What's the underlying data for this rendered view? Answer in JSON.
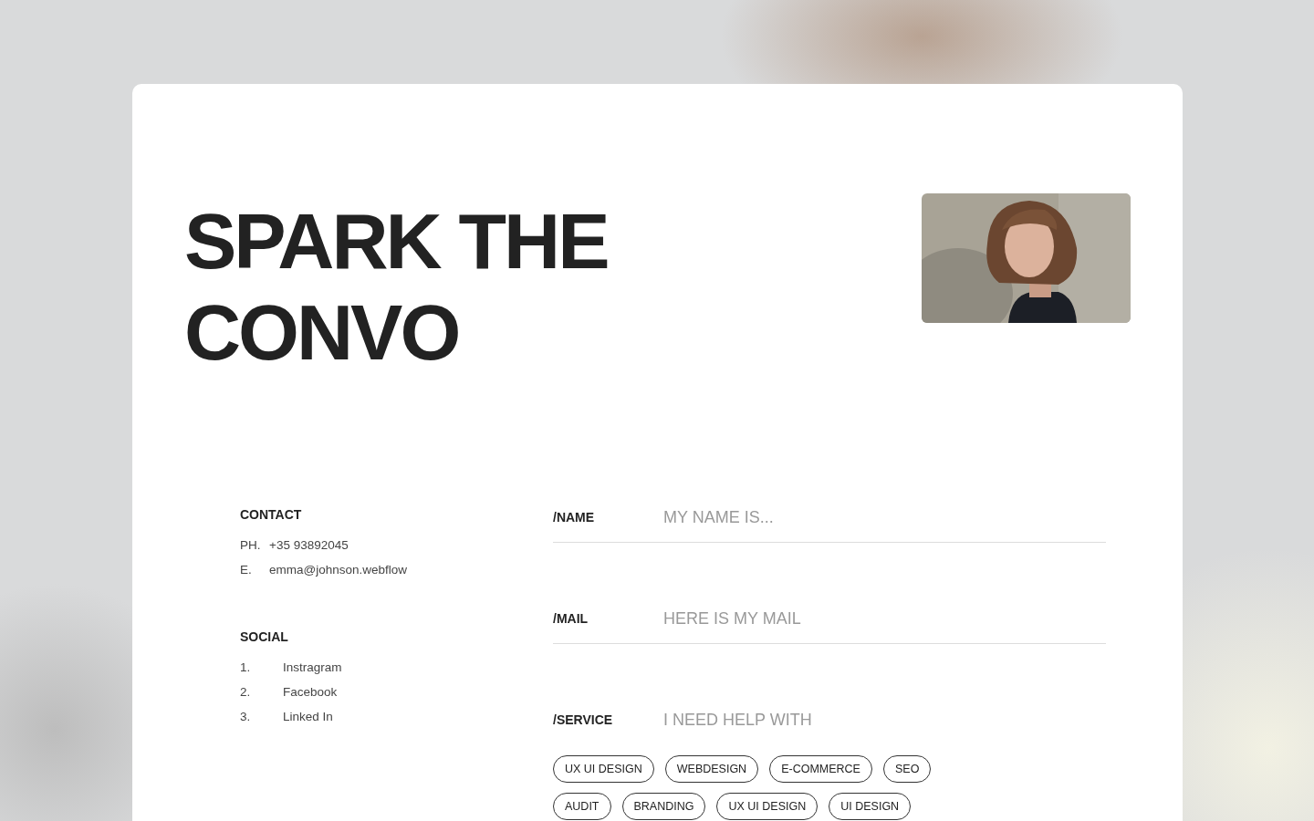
{
  "heading": {
    "lines": [
      "SPARK THE",
      "CONVO"
    ]
  },
  "contact": {
    "title": "CONTACT",
    "items": [
      {
        "label": "PH.",
        "value": "+35 93892045"
      },
      {
        "label": "E.",
        "value": "emma@johnson.webflow"
      }
    ]
  },
  "social": {
    "title": "SOCIAL",
    "items": [
      {
        "number": "1.",
        "label": "Instragram"
      },
      {
        "number": "2.",
        "label": "Facebook"
      },
      {
        "number": "3.",
        "label": "Linked In"
      }
    ]
  },
  "form": {
    "fields": [
      {
        "label": "/NAME",
        "placeholder": "MY NAME IS...",
        "underlined": true
      },
      {
        "label": "/MAIL",
        "placeholder": "HERE IS MY MAIL",
        "underlined": true
      },
      {
        "label": "/SERVICE",
        "placeholder": "I NEED HELP WITH",
        "underlined": false
      }
    ],
    "services": [
      [
        "UX UI DESIGN",
        "WEBDESIGN",
        "E-COMMERCE",
        "SEO"
      ],
      [
        "AUDIT",
        "BRANDING",
        "UX UI DESIGN",
        "UI DESIGN"
      ]
    ]
  }
}
